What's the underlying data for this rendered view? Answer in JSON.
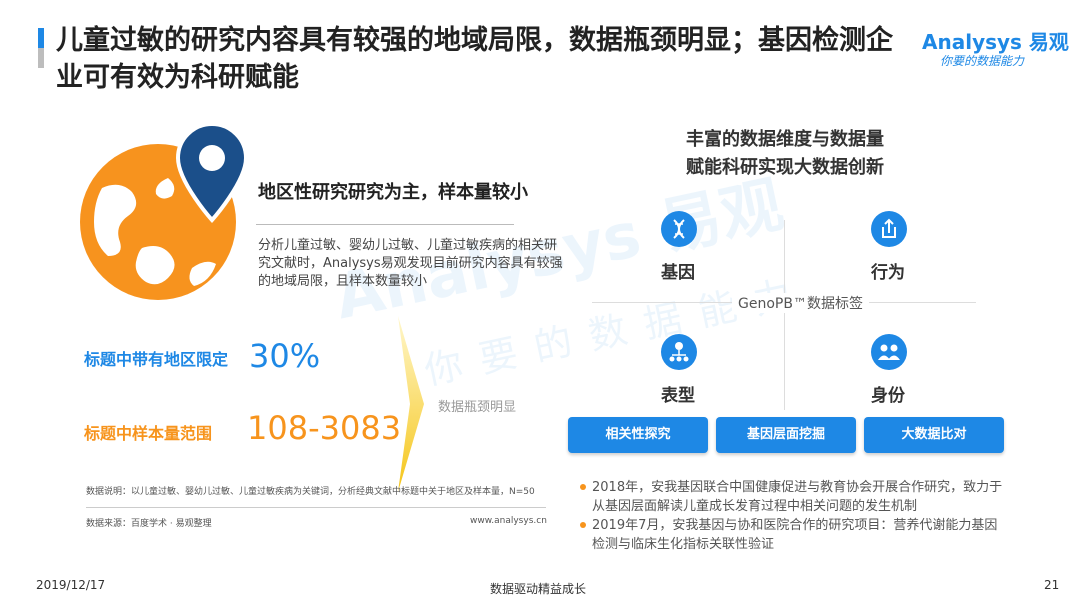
{
  "header": {
    "title": "儿童过敏的研究内容具有较强的地域局限，数据瓶颈明显；基因检测企业可有效为科研赋能",
    "logo": {
      "brand": "Analysys 易观",
      "slogan": "你要的数据能力"
    }
  },
  "watermark": {
    "main": "Analysys 易观",
    "sub": "你要的数据能力"
  },
  "left": {
    "region_title": "地区性研究研究为主，样本量较小",
    "region_desc": "分析儿童过敏、婴幼儿过敏、儿童过敏疾病的相关研究文献时，Analysys易观发现目前研究内容具有较强的地域局限，且样本数量较小",
    "stats": [
      {
        "label": "标题中带有地区限定",
        "value": "30%"
      },
      {
        "label": "标题中样本量范围",
        "value": "108-3083"
      }
    ],
    "bottleneck": "数据瓶颈明显",
    "note": "数据说明：以儿童过敏、婴幼儿过敏、儿童过敏疾病为关键词，分析经典文献中标题中关于地区及样本量，N=50",
    "source": "数据来源：百度学术 · 易观整理",
    "website": "www.analysys.cn"
  },
  "right": {
    "title_line1": "丰富的数据维度与数据量",
    "title_line2": "赋能科研实现大数据创新",
    "center_label": "GenoPB™数据标签",
    "dimensions": [
      {
        "label": "基因",
        "icon": "dna-icon"
      },
      {
        "label": "行为",
        "icon": "behavior-icon"
      },
      {
        "label": "表型",
        "icon": "phenotype-icon"
      },
      {
        "label": "身份",
        "icon": "identity-icon"
      }
    ],
    "buttons": [
      "相关性探究",
      "基因层面挖掘",
      "大数据比对"
    ],
    "bullets": [
      "2018年，安我基因联合中国健康促进与教育协会开展合作研究，致力于从基因层面解读儿童成长发育过程中相关问题的发生机制",
      "2019年7月，安我基因与协和医院合作的研究项目：营养代谢能力基因检测与临床生化指标关联性验证"
    ]
  },
  "footer": {
    "date": "2019/12/17",
    "center": "数据驱动精益成长",
    "page": "21"
  },
  "colors": {
    "accent_blue": "#1e88e5",
    "accent_orange": "#f7941d",
    "globe_orange": "#f7931e",
    "pin_navy": "#1b4f8a"
  }
}
